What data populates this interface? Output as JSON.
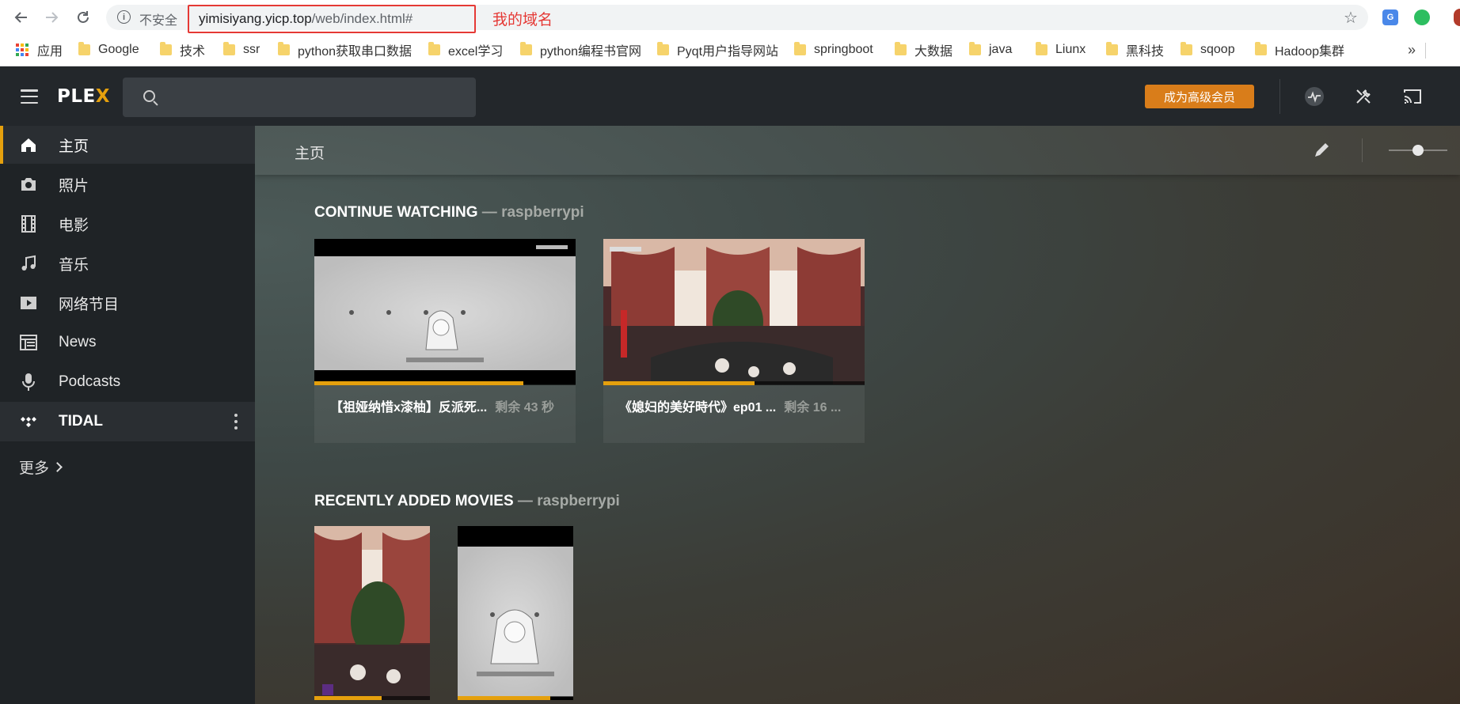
{
  "browser": {
    "security_label": "不安全",
    "url_host": "yimisiyang.yicp.top",
    "url_path": "/web/index.html#",
    "annotation": "我的域名",
    "translate_label": "G",
    "bookmarks": [
      "应用",
      "Google",
      "技术",
      "ssr",
      "python获取串口数据",
      "excel学习",
      "python编程书官网",
      "Pyqt用户指导网站",
      "springboot",
      "大数据",
      "java",
      "Liunx",
      "黑科技",
      "sqoop",
      "Hadoop集群"
    ],
    "more_bookmarks": "»"
  },
  "header": {
    "logo_main": "PLE",
    "logo_x": "X",
    "search_placeholder": "",
    "premium_label": "成为高级会员"
  },
  "sidebar": {
    "items": [
      {
        "label": "主页",
        "icon": "home-icon"
      },
      {
        "label": "照片",
        "icon": "camera-icon"
      },
      {
        "label": "电影",
        "icon": "film-icon"
      },
      {
        "label": "音乐",
        "icon": "music-icon"
      },
      {
        "label": "网络节目",
        "icon": "play-icon"
      },
      {
        "label": "News",
        "icon": "news-icon"
      },
      {
        "label": "Podcasts",
        "icon": "microphone-icon"
      },
      {
        "label": "TIDAL",
        "icon": "tidal-icon"
      }
    ],
    "more_label": "更多"
  },
  "main": {
    "page_title": "主页",
    "size_slider_value": 0.5,
    "continue_watching": {
      "title": "CONTINUE WATCHING",
      "separator": " — ",
      "server": "raspberrypi",
      "items": [
        {
          "title": "【祖娅纳惜x漆柚】反派死...",
          "remaining": "剩余 43 秒",
          "progress": 0.8
        },
        {
          "title": "《媳妇的美好時代》ep01 ...",
          "remaining": "剩余 16 ...",
          "progress": 0.58
        }
      ]
    },
    "recently_added": {
      "title": "RECENTLY ADDED MOVIES",
      "separator": " — ",
      "server": "raspberrypi",
      "items": [
        {
          "name": "poster-1",
          "progress": 0.58
        },
        {
          "name": "poster-2",
          "progress": 0.8
        }
      ]
    }
  },
  "colors": {
    "accent": "#e5a00d",
    "premium": "#d97d1a",
    "annotation_red": "#e53935"
  }
}
